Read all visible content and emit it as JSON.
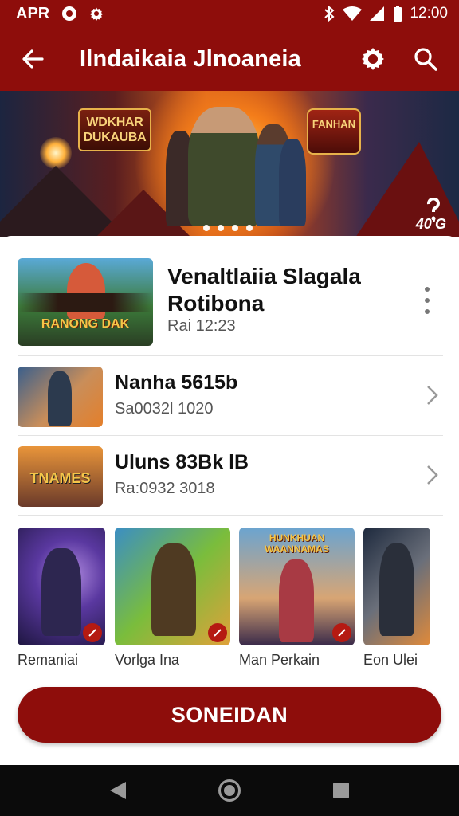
{
  "status_bar": {
    "carrier": "APR",
    "time": "12:00",
    "icons": [
      "circle-icon",
      "gear-icon",
      "bluetooth-icon",
      "wifi-icon",
      "signal-icon",
      "battery-icon"
    ]
  },
  "app_bar": {
    "title": "Ilndaikaia Jlnoaneia",
    "icons": [
      "back-arrow-icon",
      "settings-icon",
      "search-icon"
    ]
  },
  "banner": {
    "logo_left": "WDKHAR DUKAUBA",
    "logo_right": "FANHAN",
    "badge": "40'G",
    "page_count": 4
  },
  "featured": {
    "title": "Venaltlaiia Slagala Rotibona",
    "subtitle": "Rai 12:23",
    "thumb_text": "RANONG DAK"
  },
  "list": [
    {
      "title": "Nanha 5615b",
      "subtitle": "Sa0032l 1020"
    },
    {
      "title": "Uluns 83Bk lB",
      "subtitle": "Ra:0932 3018",
      "thumb_text": "TNAMES"
    }
  ],
  "tiles": [
    {
      "label": "Remaniai"
    },
    {
      "label": "Vorlga Ina"
    },
    {
      "label": "Man Perkain",
      "thumb_text": "HUNKHUAN WAANNAMAS"
    },
    {
      "label": "Eon Ulei"
    }
  ],
  "cta": {
    "label": "SONEIDAN"
  },
  "colors": {
    "primary": "#8e0d0b",
    "accent": "#b51a12",
    "text": "#111111",
    "muted": "#555555"
  }
}
